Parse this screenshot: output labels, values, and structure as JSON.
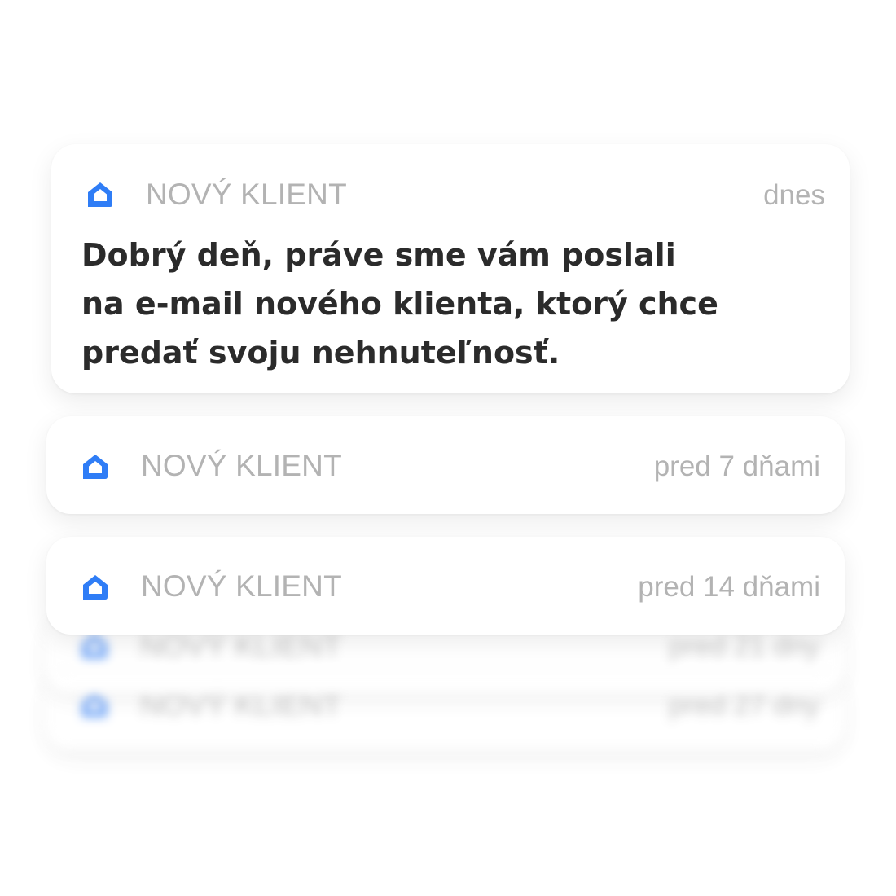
{
  "colors": {
    "accent": "#2f7df6",
    "muted_text": "#b3b3b3",
    "body_text": "#2b2b2b",
    "card_background": "#ffffff"
  },
  "notifications": [
    {
      "icon": "home-icon",
      "app_name": "NOVÝ KLIENT",
      "time": "dnes",
      "message_lines": [
        "Dobrý deň, práve sme vám poslali",
        "na e-mail nového klienta, ktorý chce",
        "predať svoju nehnuteľnosť."
      ]
    },
    {
      "icon": "home-icon",
      "app_name": "NOVÝ KLIENT",
      "time": "pred 7 dňami"
    },
    {
      "icon": "home-icon",
      "app_name": "NOVÝ KLIENT",
      "time": "pred 14 dňami"
    },
    {
      "icon": "home-icon",
      "app_name": "NOVÝ KLIENT",
      "time": "pred 21 dny"
    },
    {
      "icon": "home-icon",
      "app_name": "NOVÝ KLIENT",
      "time": "pred 27 dny"
    }
  ]
}
